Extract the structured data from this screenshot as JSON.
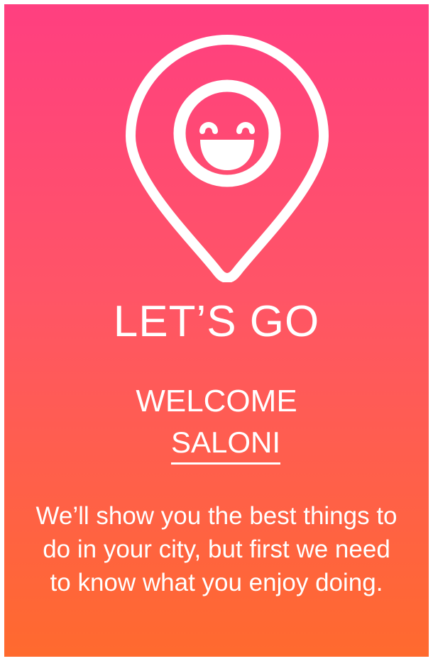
{
  "colors": {
    "gradient_top": "#ff3f80",
    "gradient_mid": "#ff5566",
    "gradient_bottom": "#ff6a2e",
    "text": "#ffffff"
  },
  "logo": {
    "icon": "location-pin-smiley-icon"
  },
  "hero": {
    "title": "LET’S GO"
  },
  "welcome": {
    "greeting": "WELCOME",
    "username": "SALONI"
  },
  "intro": {
    "text": "We’ll show you the best things to do in your city, but first we need to know what you enjoy doing."
  }
}
